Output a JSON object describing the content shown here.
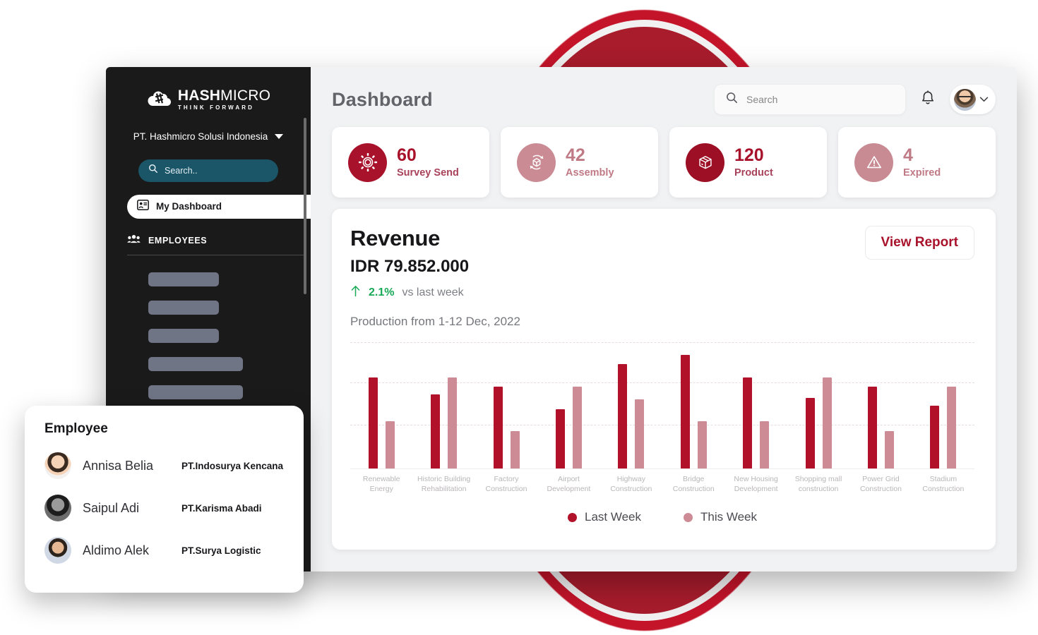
{
  "brand": {
    "accent_dark_red": "#b1122a",
    "accent_light_red": "#cd8c95",
    "sidebar_bg": "#1a1a1a",
    "search_pill": "#1a5568",
    "positive_green": "#18a957"
  },
  "sidebar": {
    "logo_main": "HASH",
    "logo_main_thin": "MICRO",
    "logo_sub": "THINK FORWARD",
    "company": "PT. Hashmicro Solusi Indonesia",
    "search_placeholder": "Search..",
    "nav_active": "My Dashboard",
    "section_label": "EMPLOYEES",
    "skeleton_widths": [
      100,
      100,
      100,
      134,
      134
    ]
  },
  "header": {
    "title": "Dashboard",
    "search_placeholder": "Search",
    "search_value": "",
    "bell_icon": "bell-icon",
    "avatar_caret": "chevron-down-icon"
  },
  "stats": [
    {
      "value": "60",
      "label": "Survey Send",
      "icon": "gear-icon",
      "icon_bg": "#a8122b",
      "value_color": "#a8122b",
      "label_color": "#a8415a"
    },
    {
      "value": "42",
      "label": "Assembly",
      "icon": "assembly-icon",
      "icon_bg": "#ca8b94",
      "value_color": "#c07a86",
      "label_color": "#c07a86"
    },
    {
      "value": "120",
      "label": "Product",
      "icon": "package-icon",
      "icon_bg": "#9c0f24",
      "value_color": "#a8122b",
      "label_color": "#a8415a"
    },
    {
      "value": "4",
      "label": "Expired",
      "icon": "warning-icon",
      "icon_bg": "#c98b93",
      "value_color": "#c07a86",
      "label_color": "#c07a86"
    }
  ],
  "revenue": {
    "title": "Revenue",
    "amount": "IDR 79.852.000",
    "delta_arrow": "arrow-up-icon",
    "delta_pct": "2.1%",
    "delta_note": "vs last week",
    "subtitle": "Production from 1-12 Dec, 2022",
    "view_report_label": "View Report"
  },
  "chart_data": {
    "type": "bar",
    "title": "Production from 1-12 Dec, 2022",
    "xlabel": "",
    "ylabel": "",
    "ylim": [
      0,
      100
    ],
    "grid": true,
    "gridlines": [
      32,
      62
    ],
    "legend_position": "bottom-center",
    "categories": [
      "Renewable Energy",
      "Historic Building Rehabilitation",
      "Factory Construction",
      "Airport Development",
      "Highway Construction",
      "Bridge Construction",
      "New Housing Development",
      "Shopping mall construction",
      "Power Grid Construction",
      "Stadium Construction"
    ],
    "categories_lines": [
      [
        "Renewable",
        "Energy"
      ],
      [
        "Historic Building",
        "Rehabilitation"
      ],
      [
        "Factory",
        "Construction"
      ],
      [
        "Airport",
        "Development"
      ],
      [
        "Highway",
        "Construction"
      ],
      [
        "Bridge",
        "Construction"
      ],
      [
        "New Housing",
        "Development"
      ],
      [
        "Shopping mall",
        "construction"
      ],
      [
        "Power Grid",
        "Construction"
      ],
      [
        "Stadium",
        "Construction"
      ]
    ],
    "series": [
      {
        "name": "Last Week",
        "color": "#b1122a",
        "values": [
          72,
          59,
          65,
          47,
          83,
          90,
          72,
          56,
          65,
          50
        ]
      },
      {
        "name": "This Week",
        "color": "#cd8c95",
        "values": [
          38,
          72,
          30,
          65,
          55,
          38,
          38,
          72,
          30,
          65
        ]
      }
    ],
    "legend": [
      {
        "label": "Last Week",
        "color": "#b1122a"
      },
      {
        "label": "This Week",
        "color": "#cd8c95"
      }
    ]
  },
  "employee_panel": {
    "title": "Employee",
    "rows": [
      {
        "name": "Annisa Belia",
        "company": "PT.Indosurya Kencana",
        "avatar": "avatar-annisa"
      },
      {
        "name": "Saipul Adi",
        "company": "PT.Karisma Abadi",
        "avatar": "avatar-saipul"
      },
      {
        "name": "Aldimo Alek",
        "company": "PT.Surya Logistic",
        "avatar": "avatar-aldimo"
      }
    ]
  }
}
